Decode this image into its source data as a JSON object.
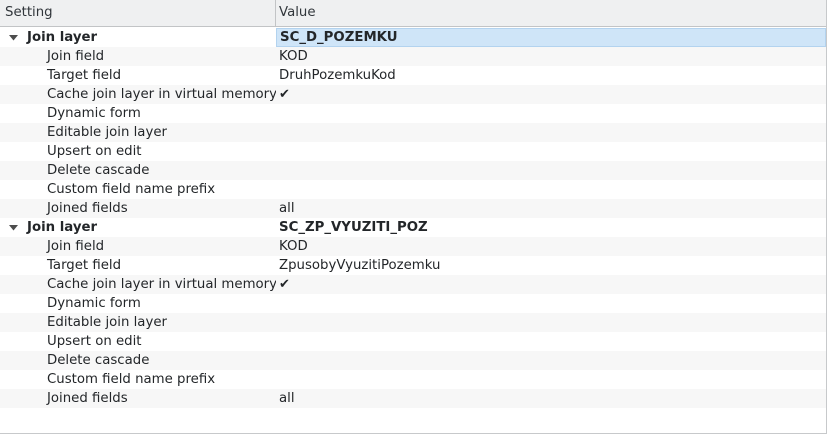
{
  "header": {
    "setting_label": "Setting",
    "value_label": "Value"
  },
  "groups": [
    {
      "label": "Join layer",
      "value": "SC_D_POZEMKU",
      "expanded": true,
      "selected": true,
      "items": [
        {
          "label": "Join field",
          "value": "KOD"
        },
        {
          "label": "Target field",
          "value": "DruhPozemkuKod"
        },
        {
          "label": "Cache join layer in virtual memory",
          "value": "✔"
        },
        {
          "label": "Dynamic form",
          "value": ""
        },
        {
          "label": "Editable join layer",
          "value": ""
        },
        {
          "label": "Upsert on edit",
          "value": ""
        },
        {
          "label": "Delete cascade",
          "value": ""
        },
        {
          "label": "Custom field name prefix",
          "value": ""
        },
        {
          "label": "Joined fields",
          "value": "all"
        }
      ]
    },
    {
      "label": "Join layer",
      "value": "SC_ZP_VYUZITI_POZ",
      "expanded": true,
      "selected": false,
      "items": [
        {
          "label": "Join field",
          "value": "KOD"
        },
        {
          "label": "Target field",
          "value": "ZpusobyVyuzitiPozemku"
        },
        {
          "label": "Cache join layer in virtual memory",
          "value": "✔"
        },
        {
          "label": "Dynamic form",
          "value": ""
        },
        {
          "label": "Editable join layer",
          "value": ""
        },
        {
          "label": "Upsert on edit",
          "value": ""
        },
        {
          "label": "Delete cascade",
          "value": ""
        },
        {
          "label": "Custom field name prefix",
          "value": ""
        },
        {
          "label": "Joined fields",
          "value": "all"
        }
      ]
    }
  ],
  "colors": {
    "header_bg": "#eff0f1",
    "alt_row_bg": "#f7f7f7",
    "selection_bg": "#cfe5f8",
    "text": "#232629"
  }
}
